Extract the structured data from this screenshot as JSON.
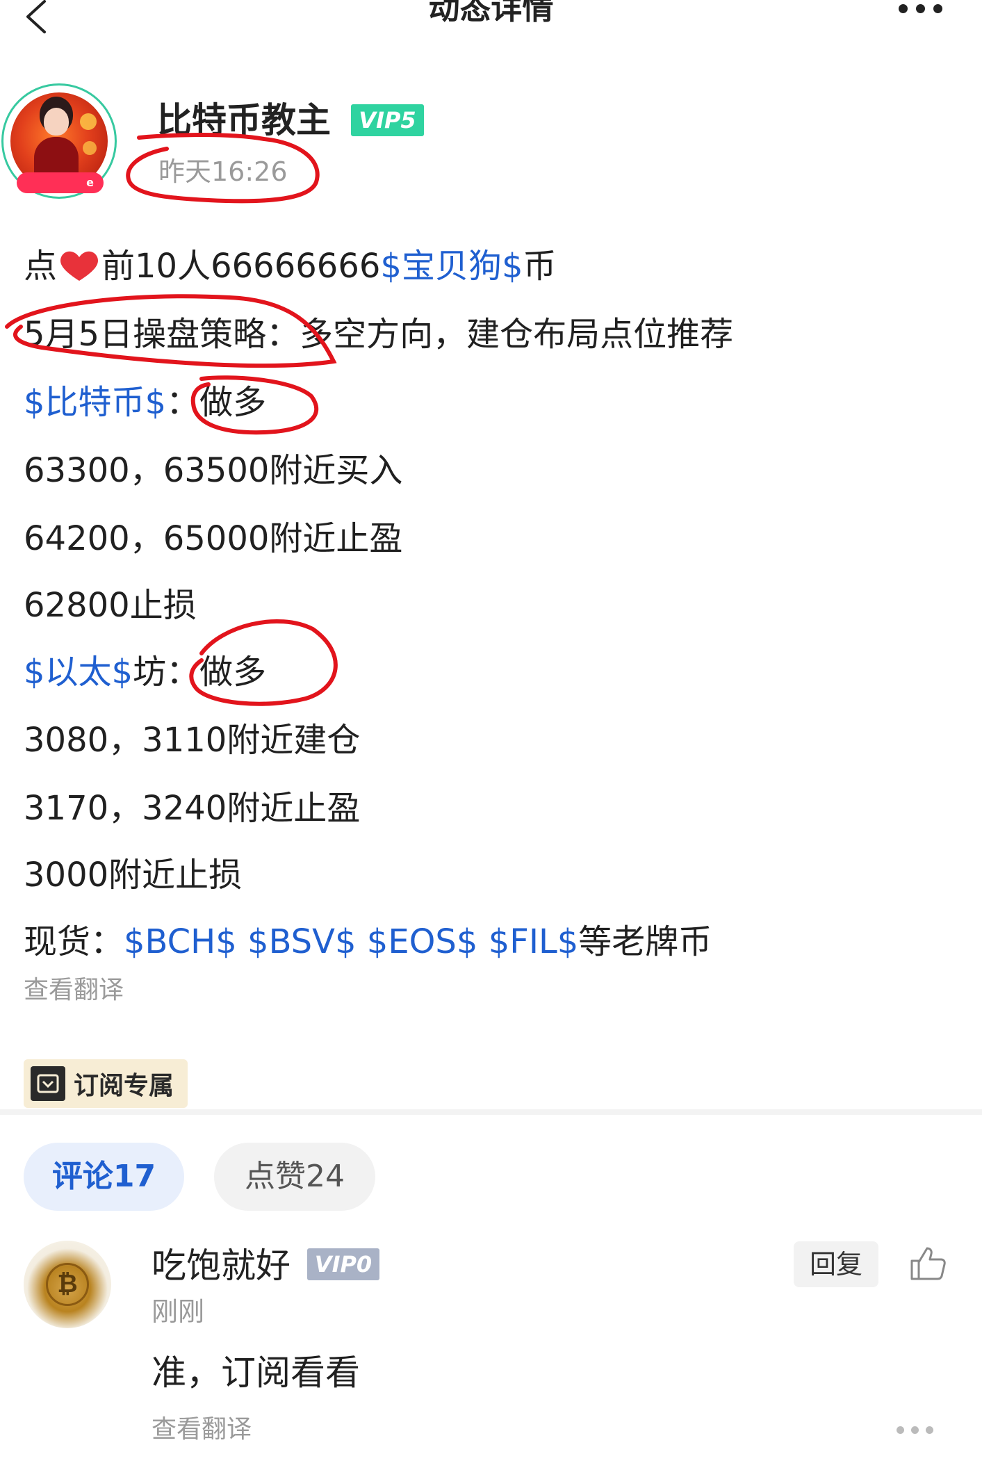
{
  "header": {
    "title": "动态详情"
  },
  "author": {
    "name": "比特币教主",
    "vip": "VIP5",
    "time": "昨天16:26"
  },
  "post": {
    "line1": {
      "a": "点",
      "b": "前10人66666666",
      "c": "$宝贝狗$",
      "d": "币"
    },
    "line2": {
      "a": "5月5日操盘策略：",
      "b": "多空方向，建仓布局点位推荐"
    },
    "line3": {
      "a": "$比特币$",
      "b": "：做多"
    },
    "line4": "63300，63500附近买入",
    "line5": "64200，65000附近止盈",
    "line6": "62800止损",
    "line7": {
      "a": "$以太$",
      "b": "坊：做多"
    },
    "line8": "3080，3110附近建仓",
    "line9": "3170，3240附近止盈",
    "line10": "3000附近止损",
    "line11": {
      "a": "现货：",
      "b": "$BCH$ $BSV$ $EOS$ $FIL$",
      "c": "等老牌币"
    },
    "translate": "查看翻译"
  },
  "subscribe_tag": "订阅专属",
  "tabs": {
    "comments": "评论17",
    "likes": "点赞24"
  },
  "comment": {
    "name": "吃饱就好",
    "vip": "VIP0",
    "time": "刚刚",
    "text": "准，订阅看看",
    "translate": "查看翻译",
    "reply": "回复"
  },
  "colors": {
    "tag_blue": "#1f5fd0",
    "vip_green": "#2fd3a0",
    "annotation_red": "#e2141c"
  }
}
